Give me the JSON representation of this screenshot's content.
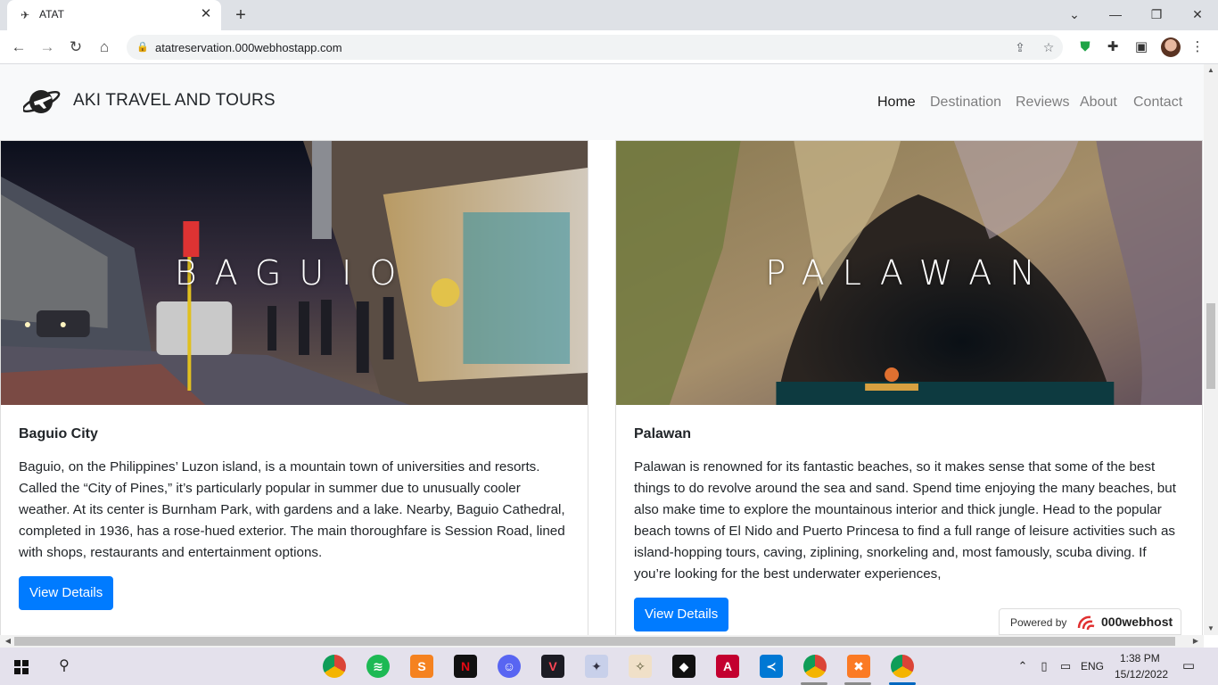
{
  "browser": {
    "tab_title": "ATAT",
    "url": "atatreservation.000webhostapp.com"
  },
  "site": {
    "brand": "AKI TRAVEL AND TOURS",
    "nav": [
      "Home",
      "Destination",
      "Reviews",
      "About",
      "Contact"
    ],
    "active_nav": "Home"
  },
  "cards": [
    {
      "overlay": "BAGUIO",
      "title": "Baguio City",
      "text": "Baguio, on the Philippines’ Luzon island, is a mountain town of universities and resorts. Called the “City of Pines,” it’s particularly popular in summer due to unusually cooler weather. At its center is Burnham Park, with gardens and a lake. Nearby, Baguio Cathedral, completed in 1936, has a rose-hued exterior. The main thoroughfare is Session Road, lined with shops, restaurants and entertainment options.",
      "button": "View Details"
    },
    {
      "overlay": "PALAWAN",
      "title": "Palawan",
      "text": "Palawan is renowned for its fantastic beaches, so it makes sense that some of the best things to do revolve around the sea and sand. Spend time enjoying the many beaches, but also make time to explore the mountainous interior and thick jungle. Head to the popular beach towns of El Nido and Puerto Princesa to find a full range of leisure activities such as island-hopping tours, caving, ziplining, snorkeling and, most famously, scuba diving. If you’re looking for the best underwater experiences,",
      "button": "View Details"
    }
  ],
  "powered_by": {
    "label": "Powered by",
    "brand": "000webhost"
  },
  "taskbar": {
    "time": "1:38 PM",
    "date": "15/12/2022",
    "language": "ENG"
  },
  "colors": {
    "primary": "#007bff",
    "navbar_bg": "#f8f9fa"
  }
}
